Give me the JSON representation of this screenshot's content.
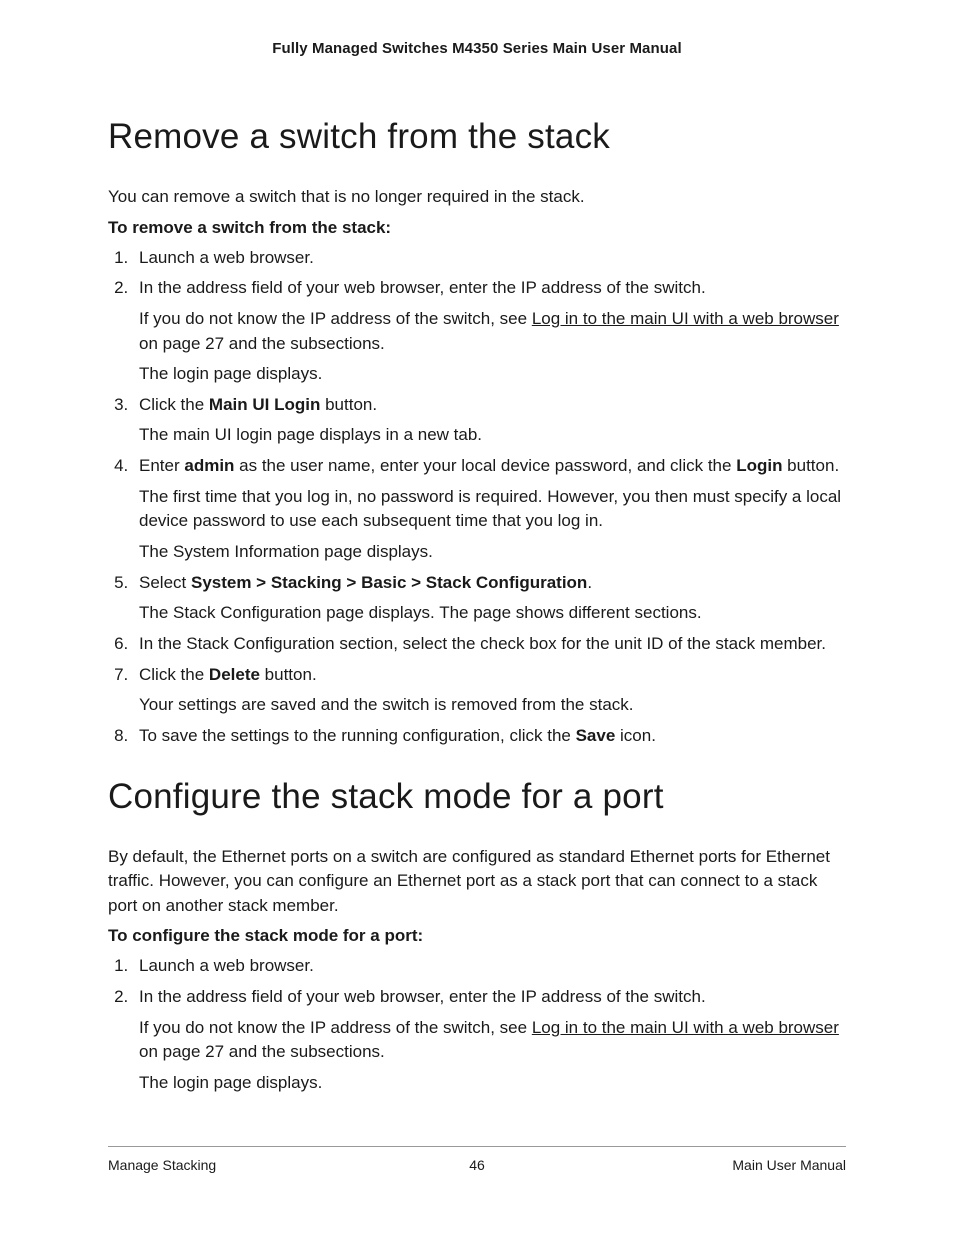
{
  "header": {
    "title": "Fully Managed Switches M4350 Series Main User Manual"
  },
  "section1": {
    "heading": "Remove a switch from the stack",
    "intro": "You can remove a switch that is no longer required in the stack.",
    "procLabel": "To remove a switch from the stack:",
    "steps": {
      "s1": "Launch a web browser.",
      "s2": "In the address field of your web browser, enter the IP address of the switch.",
      "s2_sub_a_pre": "If you do not know the IP address of the switch, see ",
      "s2_sub_a_link": "Log in to the main UI with a web browser",
      "s2_sub_a_post": " on page 27 and the subsections.",
      "s2_sub_b": "The login page displays.",
      "s3_pre": "Click the ",
      "s3_bold": "Main UI Login",
      "s3_post": " button.",
      "s3_sub": "The main UI login page displays in a new tab.",
      "s4_pre": "Enter ",
      "s4_bold1": "admin",
      "s4_mid": " as the user name, enter your local device password, and click the ",
      "s4_bold2": "Login",
      "s4_post": " button.",
      "s4_sub_a": "The first time that you log in, no password is required. However, you then must specify a local device password to use each subsequent time that you log in.",
      "s4_sub_b": "The System Information page displays.",
      "s5_pre": "Select ",
      "s5_bold": "System > Stacking > Basic > Stack Configuration",
      "s5_post": ".",
      "s5_sub": "The Stack Configuration page displays. The page shows different sections.",
      "s6": "In the Stack Configuration section, select the check box for the unit ID of the stack member.",
      "s7_pre": "Click the ",
      "s7_bold": "Delete",
      "s7_post": " button.",
      "s7_sub": "Your settings are saved and the switch is removed from the stack.",
      "s8_pre": "To save the settings to the running configuration, click the ",
      "s8_bold": "Save",
      "s8_post": " icon."
    }
  },
  "section2": {
    "heading": "Configure the stack mode for a port",
    "intro": "By default, the Ethernet ports on a switch are configured as standard Ethernet ports for Ethernet traffic. However, you can configure an Ethernet port as a stack port that can connect to a stack port on another stack member.",
    "procLabel": "To configure the stack mode for a port:",
    "steps": {
      "s1": "Launch a web browser.",
      "s2": "In the address field of your web browser, enter the IP address of the switch.",
      "s2_sub_a_pre": "If you do not know the IP address of the switch, see ",
      "s2_sub_a_link": "Log in to the main UI with a web browser",
      "s2_sub_a_post": " on page 27 and the subsections.",
      "s2_sub_b": "The login page displays."
    }
  },
  "footer": {
    "left": "Manage Stacking",
    "center": "46",
    "right": "Main User Manual"
  }
}
